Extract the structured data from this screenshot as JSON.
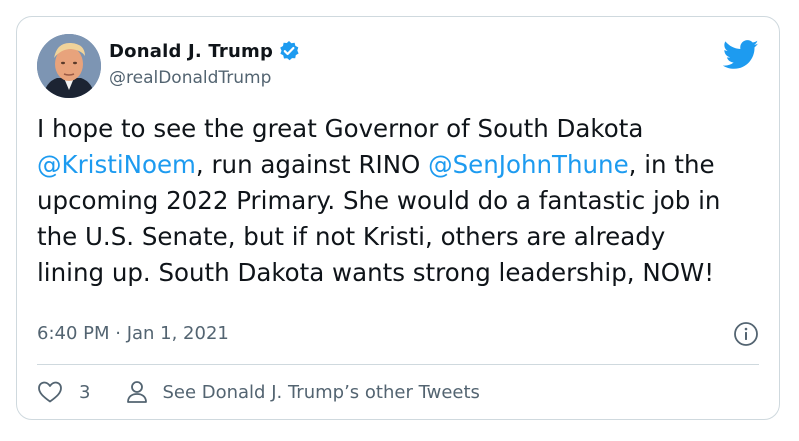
{
  "author": {
    "display_name": "Donald J. Trump",
    "handle": "@realDonaldTrump",
    "verified": true
  },
  "tweet": {
    "segments": [
      {
        "text": "I hope to see the great Governor of South Dakota ",
        "type": "text"
      },
      {
        "text": "@KristiNoem",
        "type": "mention"
      },
      {
        "text": ", run against RINO ",
        "type": "text"
      },
      {
        "text": "@SenJohnThune",
        "type": "mention"
      },
      {
        "text": ", in the upcoming 2022 Primary. She would do a fantastic job in the U.S. Senate, but if not Kristi, others are already lining up. South Dakota wants strong leadership, NOW!",
        "type": "text"
      }
    ]
  },
  "meta": {
    "timestamp": "6:40 PM · Jan 1, 2021"
  },
  "actions": {
    "like_count": "3",
    "other_tweets_label": "See Donald J. Trump’s other Tweets"
  },
  "colors": {
    "accent": "#1d9bf0",
    "text": "#0f1419",
    "secondary": "#536471",
    "border": "#cfd9de"
  },
  "icons": {
    "brand": "twitter-bird-icon",
    "verified": "verified-badge-icon",
    "info": "info-icon",
    "like": "heart-icon",
    "profile": "person-icon"
  }
}
